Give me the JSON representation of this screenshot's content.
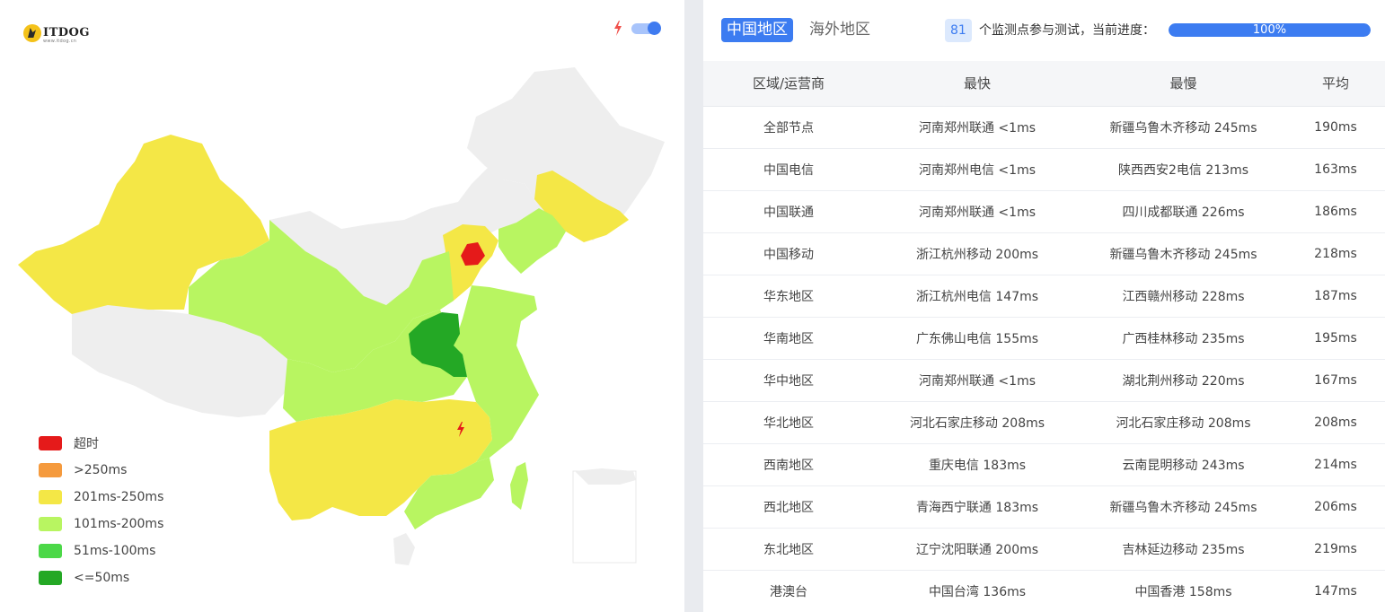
{
  "brand": {
    "name": "ITDOG",
    "subtitle": "www.itdog.cn"
  },
  "icons": {
    "flash": "bolt-icon",
    "toggle": "toggle-switch"
  },
  "colors": {
    "accent": "#3c7cf1",
    "timeout": "#e51a1a",
    "over_250": "#f59a3d",
    "ms_201_250": "#f4e746",
    "ms_101_200": "#b8f561",
    "ms_51_100": "#4cd848",
    "ms_le_50": "#24a825",
    "no_data": "#eeeeee"
  },
  "legend": [
    {
      "label": "超时",
      "color": "#e51a1a"
    },
    {
      "label": ">250ms",
      "color": "#f59a3d"
    },
    {
      "label": "201ms-250ms",
      "color": "#f4e746"
    },
    {
      "label": "101ms-200ms",
      "color": "#b8f561"
    },
    {
      "label": "51ms-100ms",
      "color": "#4cd848"
    },
    {
      "label": "<=50ms",
      "color": "#24a825"
    }
  ],
  "tabs": {
    "china": "中国地区",
    "overseas": "海外地区"
  },
  "status": {
    "node_count": "81",
    "progress_text": "个监测点参与测试，当前进度：",
    "progress_percent": 100,
    "progress_label": "100%"
  },
  "table": {
    "headers": [
      "区域/运营商",
      "最快",
      "最慢",
      "平均"
    ],
    "rows": [
      [
        "全部节点",
        "河南郑州联通 <1ms",
        "新疆乌鲁木齐移动 245ms",
        "190ms"
      ],
      [
        "中国电信",
        "河南郑州电信 <1ms",
        "陕西西安2电信 213ms",
        "163ms"
      ],
      [
        "中国联通",
        "河南郑州联通 <1ms",
        "四川成都联通 226ms",
        "186ms"
      ],
      [
        "中国移动",
        "浙江杭州移动 200ms",
        "新疆乌鲁木齐移动 245ms",
        "218ms"
      ],
      [
        "华东地区",
        "浙江杭州电信 147ms",
        "江西赣州移动 228ms",
        "187ms"
      ],
      [
        "华南地区",
        "广东佛山电信 155ms",
        "广西桂林移动 235ms",
        "195ms"
      ],
      [
        "华中地区",
        "河南郑州联通 <1ms",
        "湖北荆州移动 220ms",
        "167ms"
      ],
      [
        "华北地区",
        "河北石家庄移动 208ms",
        "河北石家庄移动 208ms",
        "208ms"
      ],
      [
        "西南地区",
        "重庆电信 183ms",
        "云南昆明移动 243ms",
        "214ms"
      ],
      [
        "西北地区",
        "青海西宁联通 183ms",
        "新疆乌鲁木齐移动 245ms",
        "206ms"
      ],
      [
        "东北地区",
        "辽宁沈阳联通 200ms",
        "吉林延边移动 235ms",
        "219ms"
      ],
      [
        "港澳台",
        "中国台湾 136ms",
        "中国香港 158ms",
        "147ms"
      ]
    ]
  }
}
